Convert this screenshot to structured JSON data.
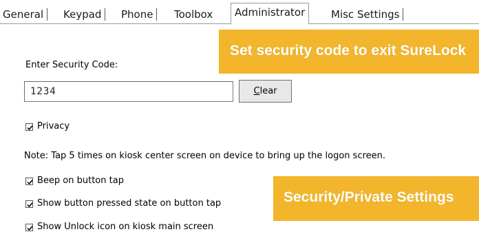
{
  "tabs": [
    {
      "label": "General",
      "active": false
    },
    {
      "label": "Keypad",
      "active": false
    },
    {
      "label": "Phone",
      "active": false
    },
    {
      "label": "Toolbox",
      "active": false
    },
    {
      "label": "Administrator",
      "active": true
    },
    {
      "label": "Misc Settings",
      "active": false
    }
  ],
  "security": {
    "label": "Enter Security Code:",
    "code_value": "1234",
    "clear_label_underlined": "C",
    "clear_label_rest": "lear"
  },
  "options": {
    "privacy": {
      "label": "Privacy",
      "checked": true
    },
    "note": "Note: Tap 5 times on kiosk center screen on device to bring up the logon screen.",
    "beep": {
      "label": "Beep on button tap",
      "checked": true
    },
    "pressed_state": {
      "label": "Show button pressed state on button tap",
      "checked": true
    },
    "unlock_icon": {
      "label": "Show Unlock icon on kiosk main screen",
      "checked": true
    }
  },
  "callouts": {
    "top": "Set security code to exit SureLock",
    "bottom": "Security/Private Settings"
  },
  "colors": {
    "callout_bg": "#f2b52b",
    "callout_text": "#ffffff",
    "tab_border": "#9a9a9a"
  }
}
